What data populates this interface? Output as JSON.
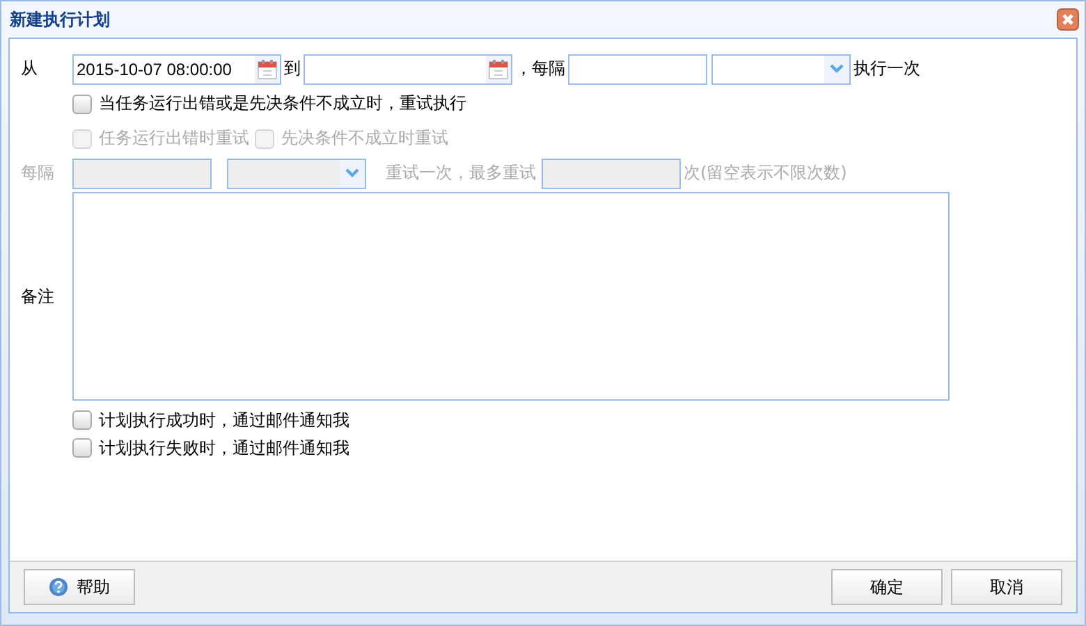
{
  "window": {
    "title": "新建执行计划"
  },
  "schedule": {
    "from_label": "从",
    "start": {
      "value": "2015-10-07 08:00:00"
    },
    "to_label": "到",
    "interval_label": "，每隔",
    "suffix": "执行一次"
  },
  "retry": {
    "label": "当任务运行出错或是先决条件不成立时，重试执行",
    "checked": false,
    "options": [
      {
        "label": "任务运行出错时重试",
        "checked": false,
        "disabled": true
      },
      {
        "label": "先决条件不成立时重试",
        "checked": false,
        "disabled": true
      }
    ],
    "interval_label": "每隔",
    "middle_text": "重试一次，最多重试",
    "suffix": "次(留空表示不限次数)",
    "disabled": true
  },
  "notes": {
    "label": "备注"
  },
  "notifications": [
    {
      "label": "计划执行成功时，通过邮件通知我",
      "checked": false
    },
    {
      "label": "计划执行失败时，通过邮件通知我",
      "checked": false
    }
  ],
  "footer": {
    "help": "帮助",
    "ok": "确定",
    "cancel": "取消"
  }
}
